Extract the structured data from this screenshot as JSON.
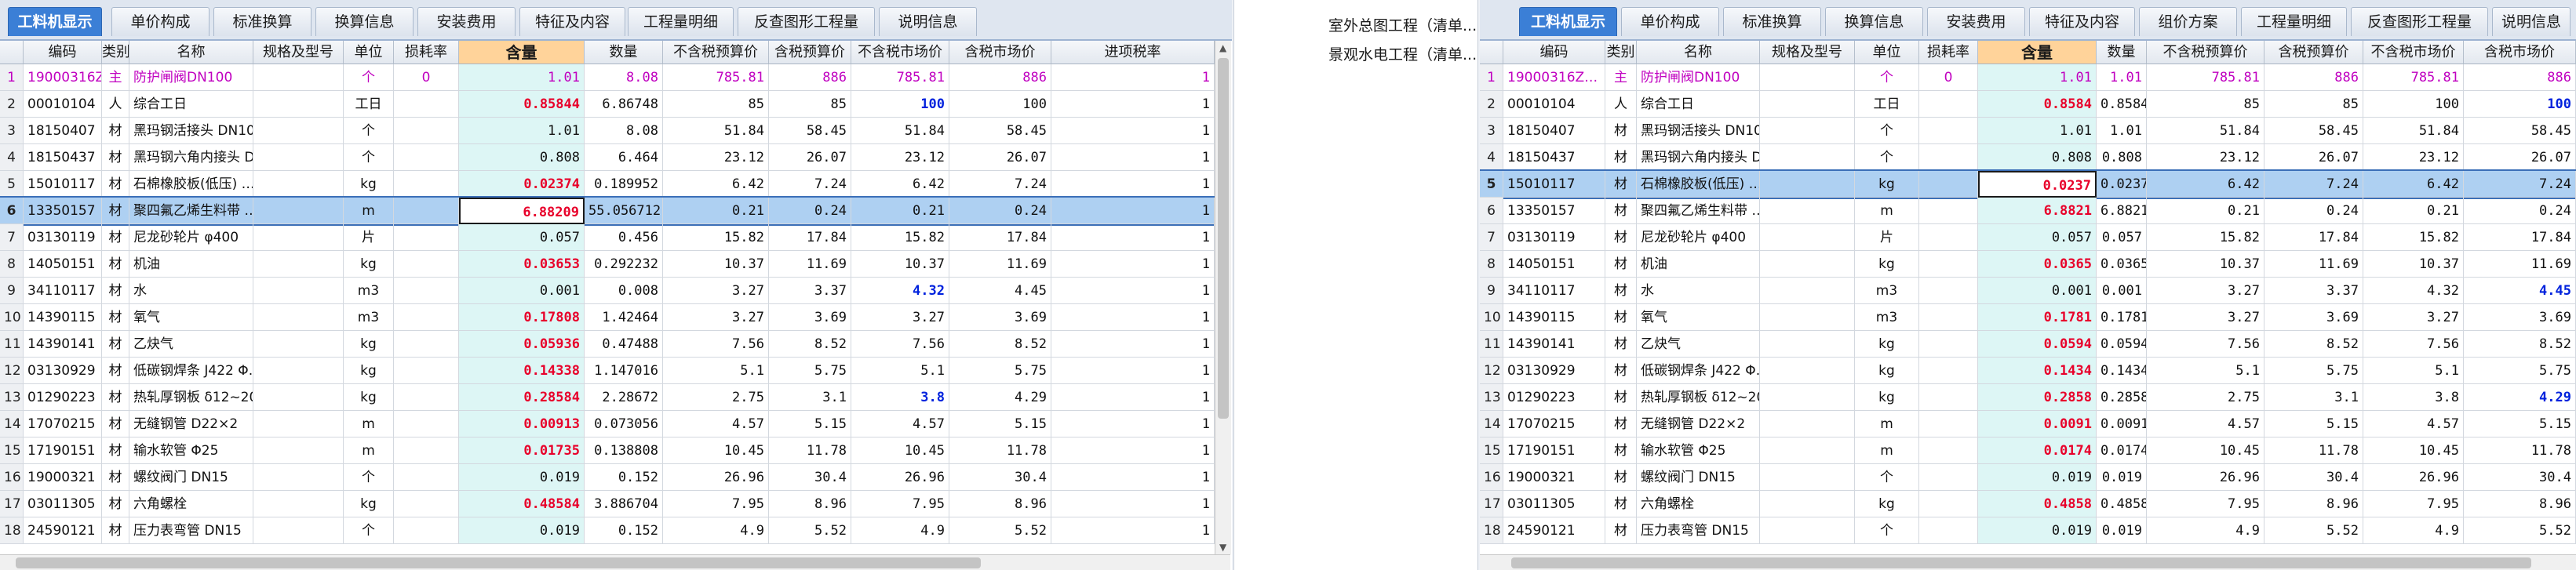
{
  "left": {
    "tabs": [
      "工料机显示",
      "单价构成",
      "标准换算",
      "换算信息",
      "安装费用",
      "特征及内容",
      "工程量明细",
      "反查图形工程量",
      "说明信息"
    ],
    "active_tab": 0,
    "columns": [
      "",
      "编码",
      "类别",
      "名称",
      "规格及型号",
      "单位",
      "损耗率",
      "含量",
      "数量",
      "不含税预算价",
      "含税预算价",
      "不含税市场价",
      "含税市场价",
      "进项税率"
    ]
  },
  "right": {
    "tabs": [
      "工料机显示",
      "单价构成",
      "标准换算",
      "换算信息",
      "安装费用",
      "特征及内容",
      "组价方案",
      "工程量明细",
      "反查图形工程量",
      "说明信息"
    ],
    "active_tab": 0,
    "columns": [
      "",
      "编码",
      "类别",
      "名称",
      "规格及型号",
      "单位",
      "损耗率",
      "含量",
      "数量",
      "不含税预算价",
      "含税预算价",
      "不含税市场价",
      "含税市场价"
    ]
  },
  "middle_tree": [
    "室外总图工程（清单...",
    "景观水电工程（清单..."
  ],
  "rows": [
    {
      "n": "1",
      "code": "19000316Z…",
      "type": "主",
      "name": "防护闸阀DN100",
      "spec": "",
      "unit": "个",
      "loss": "0",
      "qtyL": "1.01",
      "qtyR": "1.01",
      "amount": "8.08",
      "amountR": "1.01",
      "p1": "785.81",
      "p2": "886",
      "p3": "785.81",
      "p4": "886",
      "tax": "1"
    },
    {
      "n": "2",
      "code": "00010104",
      "type": "人",
      "name": "综合工日",
      "spec": "",
      "unit": "工日",
      "loss": "",
      "qtyL": "0.85844",
      "qtyR": "0.8584",
      "amount": "6.86748",
      "amountR": "0.8584",
      "p1": "85",
      "p2": "85",
      "p3": "100",
      "p4": "100",
      "tax": "1"
    },
    {
      "n": "3",
      "code": "18150407",
      "type": "材",
      "name": "黑玛钢活接头 DN100",
      "spec": "",
      "unit": "个",
      "loss": "",
      "qtyL": "1.01",
      "qtyR": "1.01",
      "amount": "8.08",
      "amountR": "1.01",
      "p1": "51.84",
      "p2": "58.45",
      "p3": "51.84",
      "p4": "58.45",
      "tax": "1"
    },
    {
      "n": "4",
      "code": "18150437",
      "type": "材",
      "name": "黑玛钢六角内接头 D…",
      "spec": "",
      "unit": "个",
      "loss": "",
      "qtyL": "0.808",
      "qtyR": "0.808",
      "amount": "6.464",
      "amountR": "0.808",
      "p1": "23.12",
      "p2": "26.07",
      "p3": "23.12",
      "p4": "26.07",
      "tax": "1"
    },
    {
      "n": "5",
      "code": "15010117",
      "type": "材",
      "name": "石棉橡胶板(低压) …",
      "spec": "",
      "unit": "kg",
      "loss": "",
      "qtyL": "0.02374",
      "qtyR": "0.0237",
      "amount": "0.189952",
      "amountR": "0.0237",
      "p1": "6.42",
      "p2": "7.24",
      "p3": "6.42",
      "p4": "7.24",
      "tax": "1"
    },
    {
      "n": "6",
      "code": "13350157",
      "type": "材",
      "name": "聚四氟乙烯生料带 …",
      "spec": "",
      "unit": "m",
      "loss": "",
      "qtyL": "6.88209",
      "qtyR": "6.8821",
      "amount": "55.056712",
      "amountR": "6.8821",
      "p1": "0.21",
      "p2": "0.24",
      "p3": "0.21",
      "p4": "0.24",
      "tax": "1"
    },
    {
      "n": "7",
      "code": "03130119",
      "type": "材",
      "name": "尼龙砂轮片 φ400",
      "spec": "",
      "unit": "片",
      "loss": "",
      "qtyL": "0.057",
      "qtyR": "0.057",
      "amount": "0.456",
      "amountR": "0.057",
      "p1": "15.82",
      "p2": "17.84",
      "p3": "15.82",
      "p4": "17.84",
      "tax": "1"
    },
    {
      "n": "8",
      "code": "14050151",
      "type": "材",
      "name": "机油",
      "spec": "",
      "unit": "kg",
      "loss": "",
      "qtyL": "0.03653",
      "qtyR": "0.0365",
      "amount": "0.292232",
      "amountR": "0.0365",
      "p1": "10.37",
      "p2": "11.69",
      "p3": "10.37",
      "p4": "11.69",
      "tax": "1"
    },
    {
      "n": "9",
      "code": "34110117",
      "type": "材",
      "name": "水",
      "spec": "",
      "unit": "m3",
      "loss": "",
      "qtyL": "0.001",
      "qtyR": "0.001",
      "amount": "0.008",
      "amountR": "0.001",
      "p1": "3.27",
      "p2": "3.37",
      "p3": "4.32",
      "p4": "4.45",
      "tax": "1"
    },
    {
      "n": "10",
      "code": "14390115",
      "type": "材",
      "name": "氧气",
      "spec": "",
      "unit": "m3",
      "loss": "",
      "qtyL": "0.17808",
      "qtyR": "0.1781",
      "amount": "1.42464",
      "amountR": "0.1781",
      "p1": "3.27",
      "p2": "3.69",
      "p3": "3.27",
      "p4": "3.69",
      "tax": "1"
    },
    {
      "n": "11",
      "code": "14390141",
      "type": "材",
      "name": "乙炔气",
      "spec": "",
      "unit": "kg",
      "loss": "",
      "qtyL": "0.05936",
      "qtyR": "0.0594",
      "amount": "0.47488",
      "amountR": "0.0594",
      "p1": "7.56",
      "p2": "8.52",
      "p3": "7.56",
      "p4": "8.52",
      "tax": "1"
    },
    {
      "n": "12",
      "code": "03130929",
      "type": "材",
      "name": "低碳钢焊条 J422 Φ…",
      "spec": "",
      "unit": "kg",
      "loss": "",
      "qtyL": "0.14338",
      "qtyR": "0.1434",
      "amount": "1.147016",
      "amountR": "0.1434",
      "p1": "5.1",
      "p2": "5.75",
      "p3": "5.1",
      "p4": "5.75",
      "tax": "1"
    },
    {
      "n": "13",
      "code": "01290223",
      "type": "材",
      "name": "热轧厚钢板 δ12~20",
      "spec": "",
      "unit": "kg",
      "loss": "",
      "qtyL": "0.28584",
      "qtyR": "0.2858",
      "amount": "2.28672",
      "amountR": "0.2858",
      "p1": "2.75",
      "p2": "3.1",
      "p3": "3.8",
      "p4": "4.29",
      "tax": "1"
    },
    {
      "n": "14",
      "code": "17070215",
      "type": "材",
      "name": "无缝钢管 D22×2",
      "spec": "",
      "unit": "m",
      "loss": "",
      "qtyL": "0.00913",
      "qtyR": "0.0091",
      "amount": "0.073056",
      "amountR": "0.0091",
      "p1": "4.57",
      "p2": "5.15",
      "p3": "4.57",
      "p4": "5.15",
      "tax": "1"
    },
    {
      "n": "15",
      "code": "17190151",
      "type": "材",
      "name": "输水软管 Φ25",
      "spec": "",
      "unit": "m",
      "loss": "",
      "qtyL": "0.01735",
      "qtyR": "0.0174",
      "amount": "0.138808",
      "amountR": "0.0174",
      "p1": "10.45",
      "p2": "11.78",
      "p3": "10.45",
      "p4": "11.78",
      "tax": "1"
    },
    {
      "n": "16",
      "code": "19000321",
      "type": "材",
      "name": "螺纹阀门 DN15",
      "spec": "",
      "unit": "个",
      "loss": "",
      "qtyL": "0.019",
      "qtyR": "0.019",
      "amount": "0.152",
      "amountR": "0.019",
      "p1": "26.96",
      "p2": "30.4",
      "p3": "26.96",
      "p4": "30.4",
      "tax": "1"
    },
    {
      "n": "17",
      "code": "03011305",
      "type": "材",
      "name": "六角螺栓",
      "spec": "",
      "unit": "kg",
      "loss": "",
      "qtyL": "0.48584",
      "qtyR": "0.4858",
      "amount": "3.886704",
      "amountR": "0.4858",
      "p1": "7.95",
      "p2": "8.96",
      "p3": "7.95",
      "p4": "8.96",
      "tax": "1"
    },
    {
      "n": "18",
      "code": "24590121",
      "type": "材",
      "name": "压力表弯管 DN15",
      "spec": "",
      "unit": "个",
      "loss": "",
      "qtyL": "0.019",
      "qtyR": "0.019",
      "amount": "0.152",
      "amountR": "0.019",
      "p1": "4.9",
      "p2": "5.52",
      "p3": "4.9",
      "p4": "5.52",
      "tax": "1"
    }
  ]
}
